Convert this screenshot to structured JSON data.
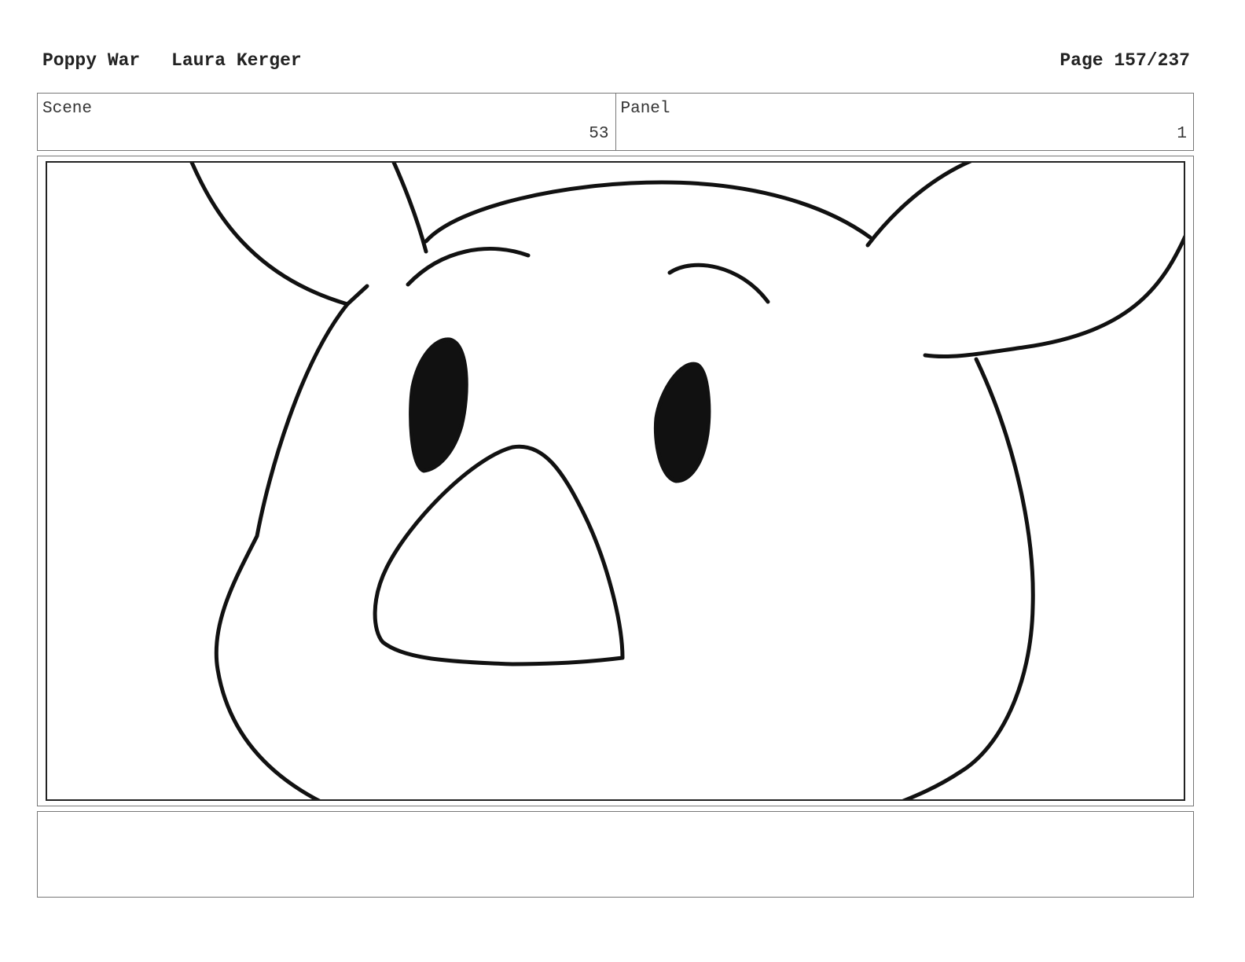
{
  "header": {
    "project": "Poppy War",
    "author": "Laura Kerger",
    "page": "Page 157/237"
  },
  "info": {
    "scene_label": "Scene",
    "scene_value": "53",
    "panel_label": "Panel",
    "panel_value": "1"
  },
  "panel_image": {
    "subject": "character-face-sketch",
    "line_color": "#111111"
  },
  "notes": {
    "text": ""
  }
}
